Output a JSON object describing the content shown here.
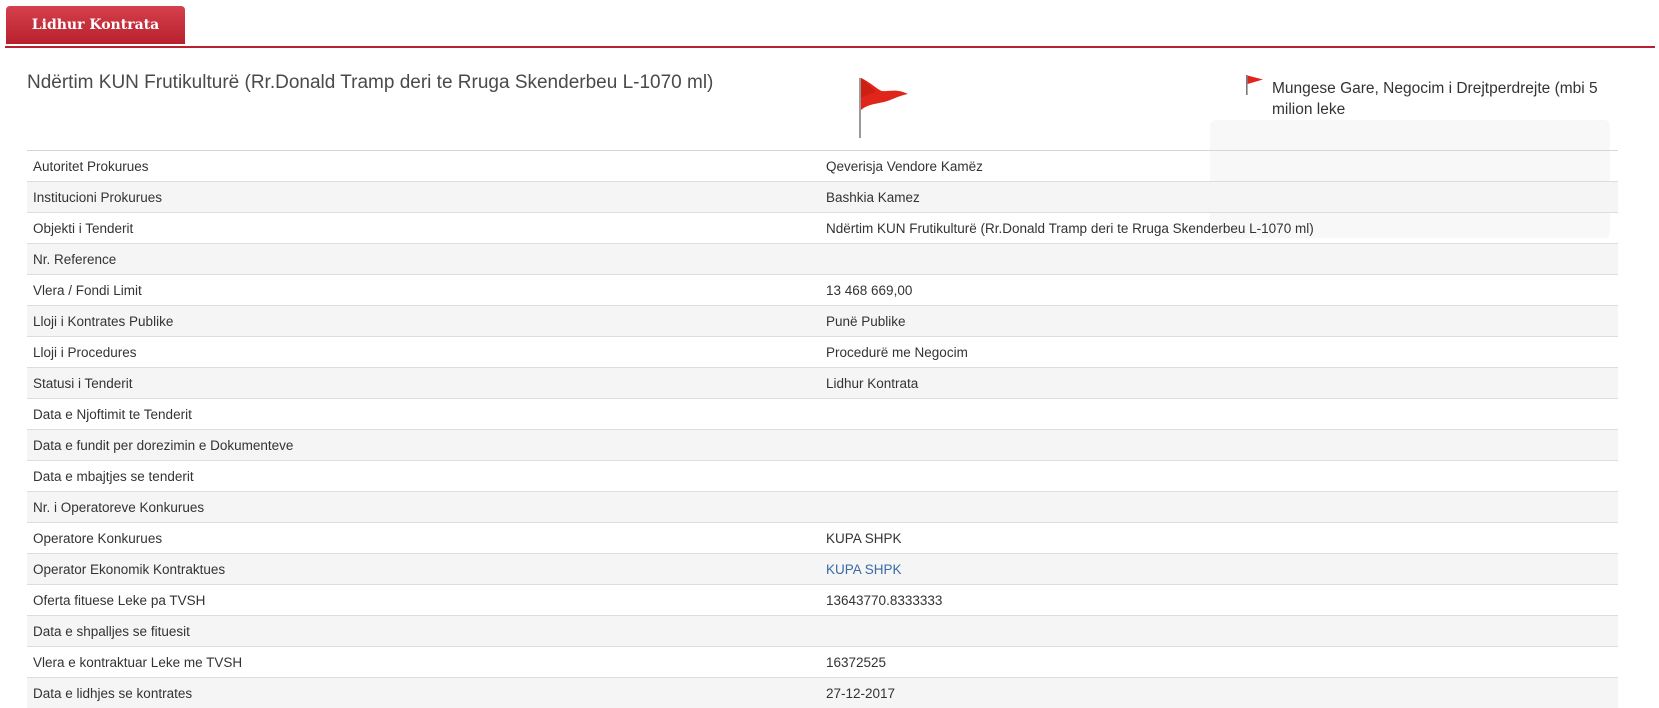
{
  "tab": {
    "label": "Lidhur Kontrata"
  },
  "title": "Ndërtim KUN Frutikulturë (Rr.Donald Tramp deri te Rruga Skenderbeu L-1070 ml)",
  "flag_note": "Mungese Gare, Negocim i Drejtperdrejte (mbi 5 milion leke",
  "colors": {
    "accent": "#b8202d",
    "flag": "#e0261a",
    "link": "#3b6aa6"
  },
  "icons": {
    "big_flag": "red-flag-icon",
    "small_flag": "red-flag-icon"
  },
  "rows": [
    {
      "label": "Autoritet Prokurues",
      "value": "Qeverisja Vendore Kamëz"
    },
    {
      "label": "Institucioni Prokurues",
      "value": "Bashkia Kamez"
    },
    {
      "label": "Objekti i Tenderit",
      "value": "Ndërtim KUN Frutikulturë (Rr.Donald Tramp deri te Rruga Skenderbeu L-1070 ml)"
    },
    {
      "label": "Nr. Reference",
      "value": ""
    },
    {
      "label": "Vlera / Fondi Limit",
      "value": "13 468 669,00"
    },
    {
      "label": "Lloji i Kontrates Publike",
      "value": "Punë Publike"
    },
    {
      "label": "Lloji i Procedures",
      "value": "Procedurë me Negocim"
    },
    {
      "label": "Statusi i Tenderit",
      "value": "Lidhur Kontrata"
    },
    {
      "label": "Data e Njoftimit te Tenderit",
      "value": ""
    },
    {
      "label": "Data e fundit per dorezimin e Dokumenteve",
      "value": ""
    },
    {
      "label": "Data e mbajtjes se tenderit",
      "value": ""
    },
    {
      "label": "Nr. i Operatoreve Konkurues",
      "value": ""
    },
    {
      "label": "Operatore Konkurues",
      "value": "KUPA SHPK"
    },
    {
      "label": "Operator Ekonomik Kontraktues",
      "value": "KUPA SHPK"
    },
    {
      "label": "Oferta fituese Leke pa TVSH",
      "value": "13643770.8333333"
    },
    {
      "label": "Data e shpalljes se fituesit",
      "value": ""
    },
    {
      "label": "Vlera e kontraktuar Leke me TVSH",
      "value": "16372525"
    },
    {
      "label": "Data e lidhjes se kontrates",
      "value": "27-12-2017"
    }
  ]
}
